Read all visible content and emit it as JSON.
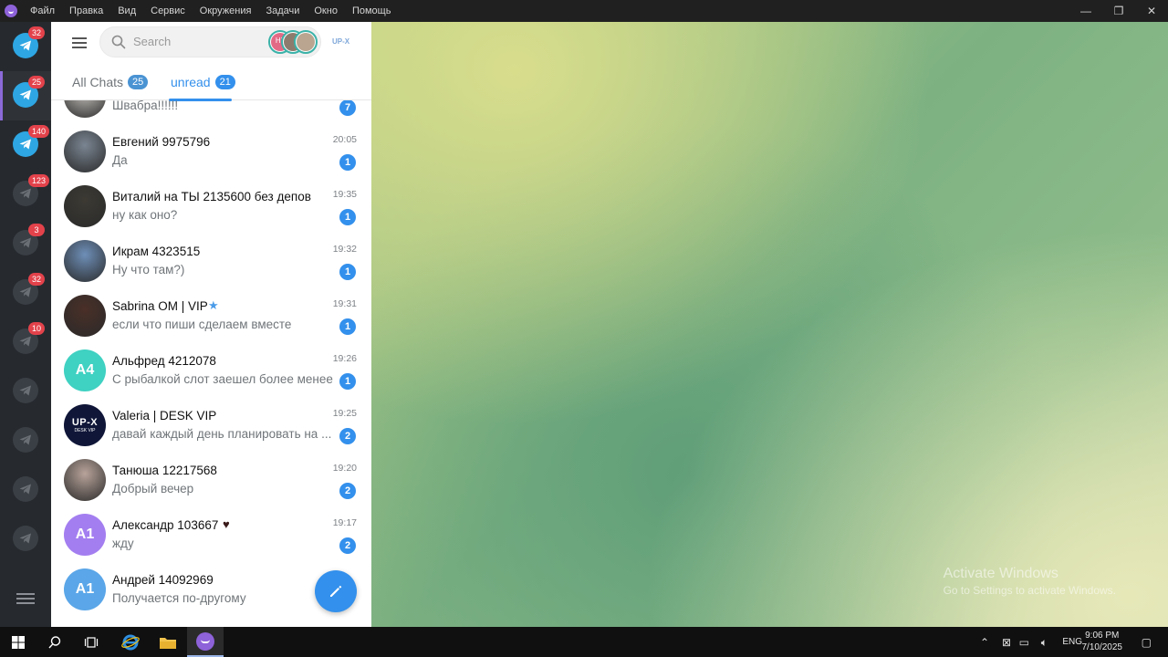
{
  "menu": {
    "items": [
      "Файл",
      "Правка",
      "Вид",
      "Сервис",
      "Окружения",
      "Задачи",
      "Окно",
      "Помощь"
    ]
  },
  "window_controls": {
    "minimize": "—",
    "maximize": "❐",
    "close": "✕"
  },
  "accounts": [
    {
      "badge": "32",
      "style": "blue"
    },
    {
      "badge": "25",
      "style": "blue",
      "active": true
    },
    {
      "badge": "140",
      "style": "blue"
    },
    {
      "badge": "123",
      "style": "dim"
    },
    {
      "badge": "3",
      "style": "dim"
    },
    {
      "badge": "32",
      "style": "dim"
    },
    {
      "badge": "10",
      "style": "dim"
    },
    {
      "badge": "",
      "style": "dim"
    },
    {
      "badge": "",
      "style": "dim"
    },
    {
      "badge": "",
      "style": "dim"
    },
    {
      "badge": "",
      "style": "dim"
    }
  ],
  "search": {
    "placeholder": "Search",
    "story_label": "H7"
  },
  "upx_label": "UP-X",
  "folders": {
    "all": {
      "label": "All Chats",
      "count": "25"
    },
    "unread": {
      "label": "unread",
      "count": "21"
    }
  },
  "chats": [
    {
      "name": "",
      "preview": "Швабра!!!!!!",
      "time": "",
      "count": "7",
      "avatar": "photo",
      "color": "#c9c5c0"
    },
    {
      "name": "Евгений 9975796",
      "preview": "Да",
      "time": "20:05",
      "count": "1",
      "avatar": "photo",
      "color": "#7a8592"
    },
    {
      "name": "Виталий на ТЫ 2135600 без депов",
      "preview": "ну как оно?",
      "time": "19:35",
      "count": "1",
      "avatar": "photo",
      "color": "#3c3a33"
    },
    {
      "name": "Икрам 4323515",
      "preview": "Ну что там?)",
      "time": "19:32",
      "count": "1",
      "avatar": "photo",
      "color": "#6e8fb8"
    },
    {
      "name": "Sabrina OM | VIP",
      "preview": "если что пиши сделаем вместе",
      "time": "19:31",
      "count": "1",
      "avatar": "photo",
      "color": "#4a2f27"
    },
    {
      "name": "Альфред 4212078",
      "preview": "С рыбалкой слот заешел более менее",
      "time": "19:26",
      "count": "1",
      "avatar": "A4",
      "color": "#3fd1c2"
    },
    {
      "name": "Valeria | DESK VIP",
      "preview": "давай каждый день планировать на ...",
      "time": "19:25",
      "count": "2",
      "avatar": "logo",
      "color": "#0f1638"
    },
    {
      "name": "Танюша 12217568",
      "preview": "Добрый вечер",
      "time": "19:20",
      "count": "2",
      "avatar": "photo",
      "color": "#b8a39a"
    },
    {
      "name": "Александр 103667",
      "preview": "жду",
      "time": "19:17",
      "count": "2",
      "avatar": "A1",
      "color": "#a37ef0"
    },
    {
      "name": "Андрей 14092969",
      "preview": "Получается по-другому",
      "time": "",
      "count": "",
      "avatar": "A1",
      "color": "#5aa6e8"
    }
  ],
  "valeria_logo": {
    "line1": "UP-X",
    "line2": "DESK VIP"
  },
  "background": {
    "activate_title": "Activate Windows",
    "activate_sub": "Go to Settings to activate Windows."
  },
  "taskbar": {
    "language": "ENG",
    "time": "9:06 PM",
    "date": "7/10/2025"
  },
  "colors": {
    "accent": "#3390ec",
    "badge_red": "#e3424b",
    "sidebar": "#262a2f"
  }
}
